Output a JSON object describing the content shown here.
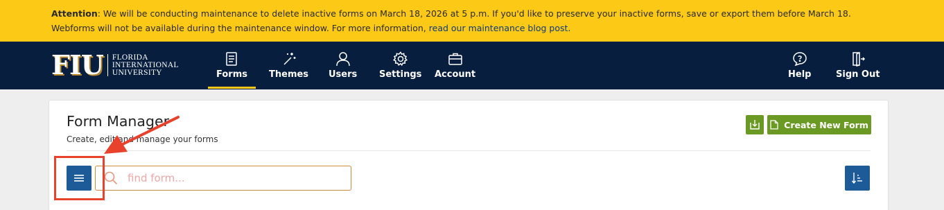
{
  "notice": {
    "label": "Attention",
    "text": ": We will be conducting maintenance to delete inactive forms on March 18, 2026 at 5 p.m. If you'd like to preserve your inactive forms, save or export them before March 18. Webforms will not be available during the maintenance window. For more information, ",
    "link": "read our maintenance blog post."
  },
  "header": {
    "logo": {
      "mark": "FIU",
      "line1": "FLORIDA",
      "line2": "INTERNATIONAL",
      "line3": "UNIVERSITY"
    },
    "nav": [
      {
        "label": "Forms",
        "icon": "forms-icon",
        "active": true
      },
      {
        "label": "Themes",
        "icon": "magic-wand-icon"
      },
      {
        "label": "Users",
        "icon": "user-icon"
      },
      {
        "label": "Settings",
        "icon": "gear-icon"
      },
      {
        "label": "Account",
        "icon": "briefcase-icon"
      },
      {
        "label": "Help",
        "icon": "help-bubble-icon"
      },
      {
        "label": "Sign Out",
        "icon": "sign-out-icon"
      }
    ]
  },
  "main": {
    "title": "Form Manager",
    "subtitle": "Create, edit and manage your forms",
    "create_button": "Create New Form",
    "search_placeholder": "find form..."
  },
  "colors": {
    "notice_bg": "#fcc916",
    "nav_bg": "#081e3f",
    "accent_gold": "#fcc916",
    "green": "#6a9a23",
    "blue": "#1d5b98",
    "annotation_red": "#e8412c"
  }
}
